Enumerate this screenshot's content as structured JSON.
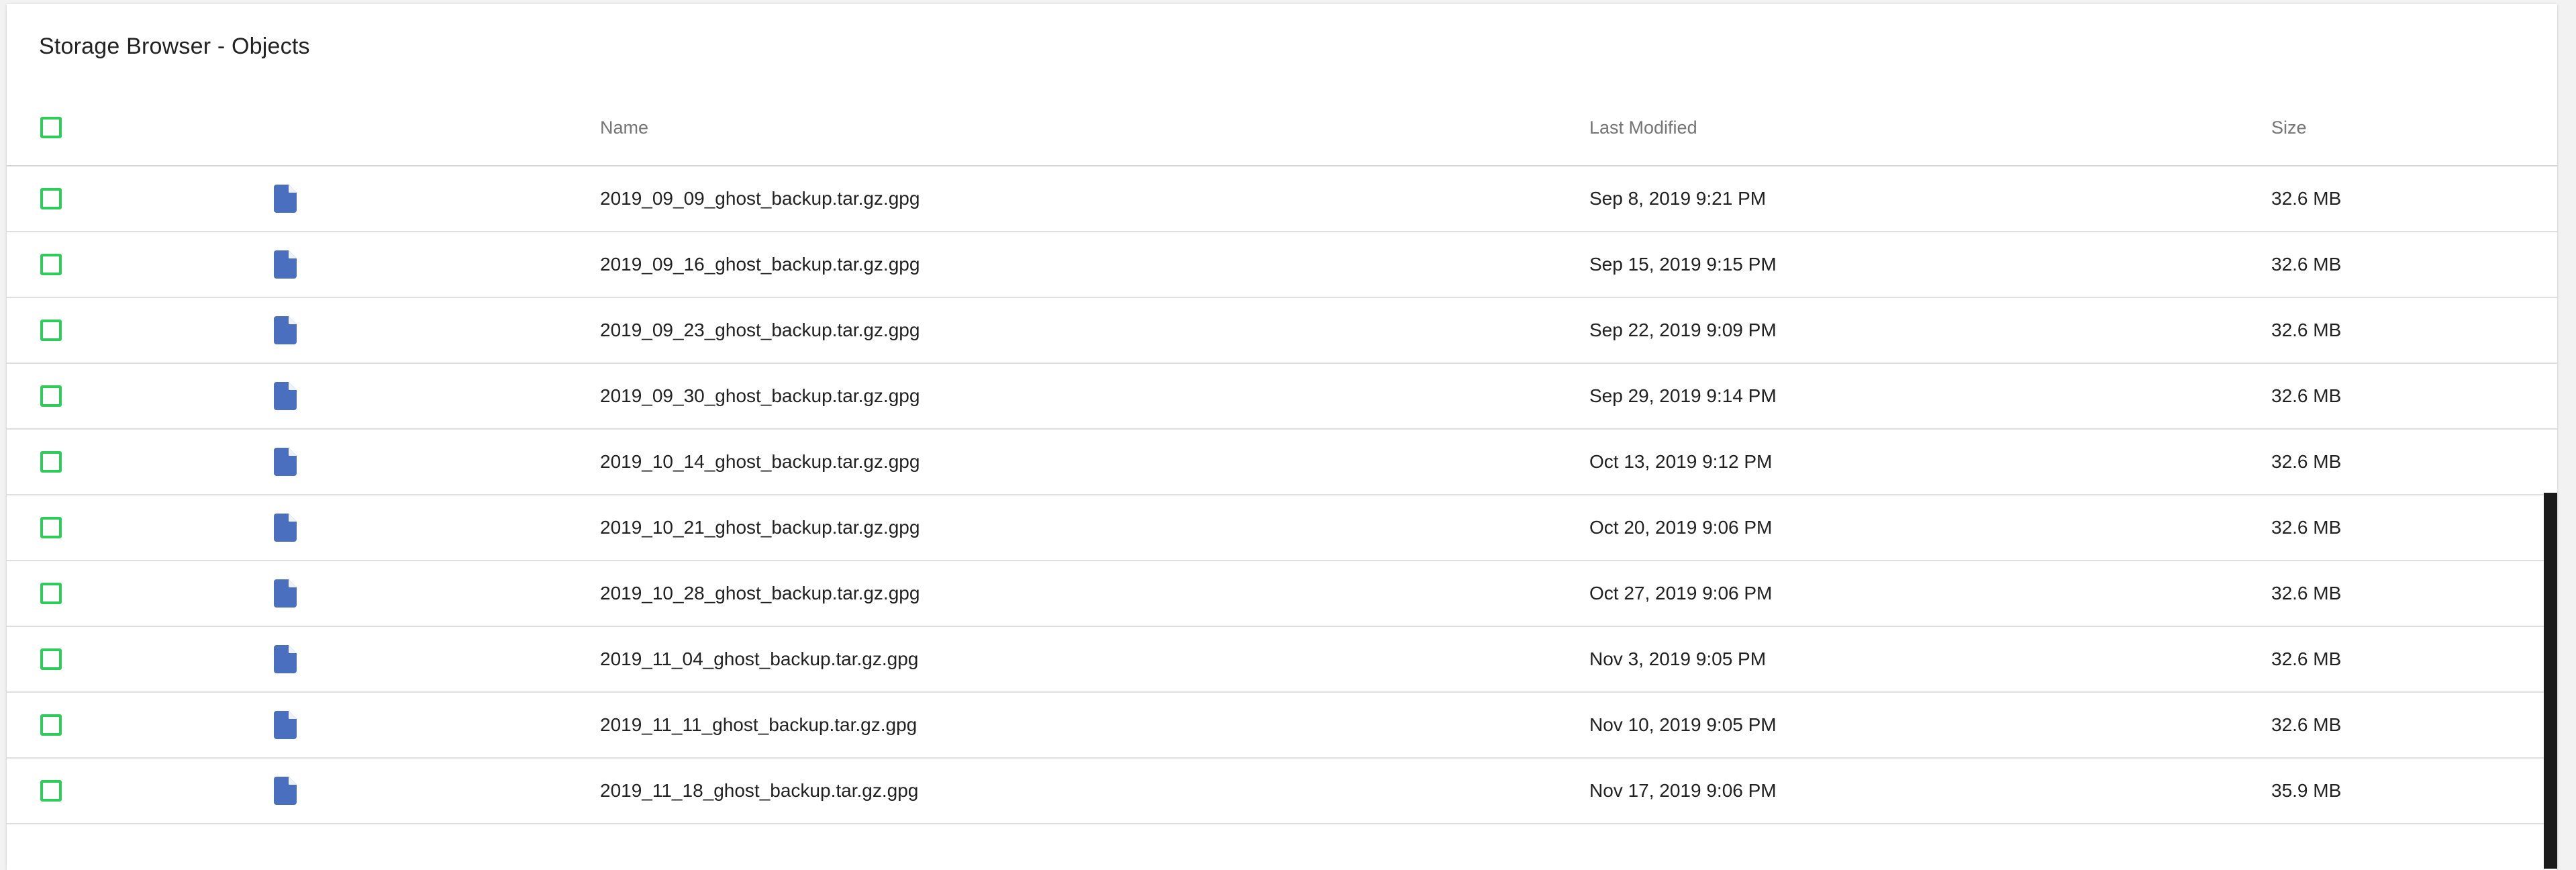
{
  "title": "Storage Browser - Objects",
  "columns": {
    "name": "Name",
    "last_modified": "Last Modified",
    "size": "Size"
  },
  "icons": {
    "file": "file-icon",
    "checkbox": "checkbox"
  },
  "colors": {
    "checkbox": "#2ecc5a",
    "file_icon": "#4a6fbf"
  },
  "rows": [
    {
      "name": "2019_09_09_ghost_backup.tar.gz.gpg",
      "modified": "Sep 8, 2019 9:21 PM",
      "size": "32.6 MB"
    },
    {
      "name": "2019_09_16_ghost_backup.tar.gz.gpg",
      "modified": "Sep 15, 2019 9:15 PM",
      "size": "32.6 MB"
    },
    {
      "name": "2019_09_23_ghost_backup.tar.gz.gpg",
      "modified": "Sep 22, 2019 9:09 PM",
      "size": "32.6 MB"
    },
    {
      "name": "2019_09_30_ghost_backup.tar.gz.gpg",
      "modified": "Sep 29, 2019 9:14 PM",
      "size": "32.6 MB"
    },
    {
      "name": "2019_10_14_ghost_backup.tar.gz.gpg",
      "modified": "Oct 13, 2019 9:12 PM",
      "size": "32.6 MB"
    },
    {
      "name": "2019_10_21_ghost_backup.tar.gz.gpg",
      "modified": "Oct 20, 2019 9:06 PM",
      "size": "32.6 MB"
    },
    {
      "name": "2019_10_28_ghost_backup.tar.gz.gpg",
      "modified": "Oct 27, 2019 9:06 PM",
      "size": "32.6 MB"
    },
    {
      "name": "2019_11_04_ghost_backup.tar.gz.gpg",
      "modified": "Nov 3, 2019 9:05 PM",
      "size": "32.6 MB"
    },
    {
      "name": "2019_11_11_ghost_backup.tar.gz.gpg",
      "modified": "Nov 10, 2019 9:05 PM",
      "size": "32.6 MB"
    },
    {
      "name": "2019_11_18_ghost_backup.tar.gz.gpg",
      "modified": "Nov 17, 2019 9:06 PM",
      "size": "35.9 MB"
    }
  ]
}
